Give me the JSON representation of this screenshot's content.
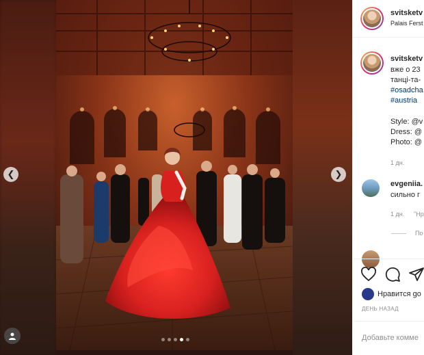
{
  "post": {
    "username": "svitsketv",
    "location": "Palais Ferst",
    "caption_line1": "вже о 23",
    "caption_line2": "танці-та-",
    "hashtag1": "#osadcha",
    "hashtag2": "#austria",
    "style_label": "Style: @v",
    "dress_label": "Dress: @",
    "photo_label": "Photo: @",
    "time": "1 дн."
  },
  "comment": {
    "username": "evgeniia.",
    "text": "сильно г",
    "time": "1 дн.",
    "reply": "\"Нр",
    "view_replies": "По"
  },
  "likes": {
    "text": "Нравится go"
  },
  "date_label": "ДЕНЬ НАЗАД",
  "add_comment_placeholder": "Добавьте комме",
  "carousel": {
    "dot_count": 5,
    "active_index": 3
  },
  "icons": {
    "prev": "chevron-left-icon",
    "next": "chevron-right-icon",
    "like": "heart-icon",
    "comment": "comment-icon",
    "share": "paper-plane-icon"
  },
  "colors": {
    "dress": "#d8211f",
    "link": "#00376b",
    "muted": "#8e8e8e"
  }
}
